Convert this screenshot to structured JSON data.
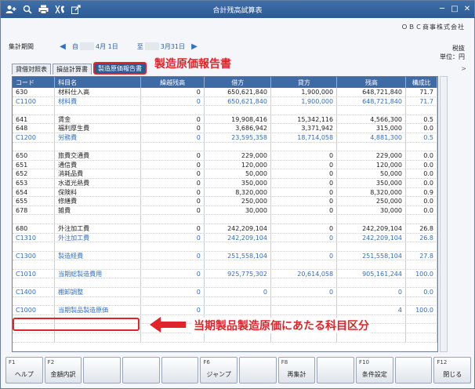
{
  "window": {
    "title": "合計残高試算表"
  },
  "company": "ＯＢＣ商事株式会社",
  "period": {
    "label": "集計期間",
    "from_prefix": "自",
    "from_date": "4月 1日",
    "to_prefix": "至",
    "to_date": "3月31日"
  },
  "tax_label": "税抜",
  "unit_label": "単位：円",
  "tabs": [
    {
      "label": "貸借対照表",
      "active": false
    },
    {
      "label": "損益計算書",
      "active": false
    },
    {
      "label": "製造原価報告書",
      "active": true
    }
  ],
  "callout_title": "製造原価報告書",
  "callout_bottom": "当期製品製造原価にあたる科目区分",
  "table": {
    "headers": [
      "コード",
      "科目名",
      "繰越残高",
      "借方",
      "貸方",
      "残高",
      "構成比"
    ],
    "rows": [
      {
        "code": "630",
        "name": "材料仕入高",
        "open": "0",
        "debit": "650,621,840",
        "credit": "1,900,000",
        "bal": "648,721,840",
        "ratio": "71.7",
        "type": "item"
      },
      {
        "code": "C1100",
        "name": "材料費",
        "open": "0",
        "debit": "650,621,840",
        "credit": "1,900,000",
        "bal": "648,721,840",
        "ratio": "71.7",
        "type": "sub"
      },
      {
        "code": "",
        "name": "",
        "open": "",
        "debit": "",
        "credit": "",
        "bal": "",
        "ratio": "",
        "type": "blank"
      },
      {
        "code": "641",
        "name": "賃金",
        "open": "0",
        "debit": "19,908,416",
        "credit": "15,342,116",
        "bal": "4,566,300",
        "ratio": "0.5",
        "type": "item"
      },
      {
        "code": "648",
        "name": "福利厚生費",
        "open": "0",
        "debit": "3,686,942",
        "credit": "3,371,942",
        "bal": "315,000",
        "ratio": "0.0",
        "type": "item"
      },
      {
        "code": "C1200",
        "name": "労務費",
        "open": "0",
        "debit": "23,595,358",
        "credit": "18,714,058",
        "bal": "4,881,300",
        "ratio": "0.5",
        "type": "sub"
      },
      {
        "code": "",
        "name": "",
        "open": "",
        "debit": "",
        "credit": "",
        "bal": "",
        "ratio": "",
        "type": "blank"
      },
      {
        "code": "650",
        "name": "旅費交通費",
        "open": "0",
        "debit": "229,000",
        "credit": "0",
        "bal": "229,000",
        "ratio": "0.0",
        "type": "item"
      },
      {
        "code": "651",
        "name": "通信費",
        "open": "0",
        "debit": "120,000",
        "credit": "0",
        "bal": "120,000",
        "ratio": "0.0",
        "type": "item"
      },
      {
        "code": "652",
        "name": "消耗品費",
        "open": "0",
        "debit": "50,000",
        "credit": "0",
        "bal": "50,000",
        "ratio": "0.0",
        "type": "item"
      },
      {
        "code": "653",
        "name": "水道光熱費",
        "open": "0",
        "debit": "350,000",
        "credit": "0",
        "bal": "350,000",
        "ratio": "0.0",
        "type": "item"
      },
      {
        "code": "654",
        "name": "保険料",
        "open": "0",
        "debit": "8,320,000",
        "credit": "0",
        "bal": "8,320,000",
        "ratio": "0.9",
        "type": "item"
      },
      {
        "code": "655",
        "name": "修繕費",
        "open": "0",
        "debit": "250,000",
        "credit": "0",
        "bal": "250,000",
        "ratio": "0.0",
        "type": "item"
      },
      {
        "code": "678",
        "name": "雑費",
        "open": "0",
        "debit": "30,000",
        "credit": "0",
        "bal": "30,000",
        "ratio": "0.0",
        "type": "item"
      },
      {
        "code": "",
        "name": "",
        "open": "",
        "debit": "",
        "credit": "",
        "bal": "",
        "ratio": "",
        "type": "blank"
      },
      {
        "code": "680",
        "name": "外注加工費",
        "open": "0",
        "debit": "242,209,104",
        "credit": "0",
        "bal": "242,209,104",
        "ratio": "26.8",
        "type": "item"
      },
      {
        "code": "C1310",
        "name": "外注加工費",
        "open": "0",
        "debit": "242,209,104",
        "credit": "0",
        "bal": "242,209,104",
        "ratio": "26.8",
        "type": "sub"
      },
      {
        "code": "",
        "name": "",
        "open": "",
        "debit": "",
        "credit": "",
        "bal": "",
        "ratio": "",
        "type": "blank"
      },
      {
        "code": "C1300",
        "name": "製造経費",
        "open": "0",
        "debit": "251,558,104",
        "credit": "0",
        "bal": "251,558,104",
        "ratio": "27.8",
        "type": "sub"
      },
      {
        "code": "",
        "name": "",
        "open": "",
        "debit": "",
        "credit": "",
        "bal": "",
        "ratio": "",
        "type": "blank"
      },
      {
        "code": "C1010",
        "name": "当期総製造費用",
        "open": "0",
        "debit": "925,775,302",
        "credit": "20,614,058",
        "bal": "905,161,244",
        "ratio": "100.0",
        "type": "sub"
      },
      {
        "code": "",
        "name": "",
        "open": "",
        "debit": "",
        "credit": "",
        "bal": "",
        "ratio": "",
        "type": "blank"
      },
      {
        "code": "C1400",
        "name": "棚卸調整",
        "open": "0",
        "debit": "0",
        "credit": "0",
        "bal": "0",
        "ratio": "0.0",
        "type": "sub"
      },
      {
        "code": "",
        "name": "",
        "open": "",
        "debit": "",
        "credit": "",
        "bal": "",
        "ratio": "",
        "type": "blank"
      },
      {
        "code": "C1000",
        "name": "当期製品製造原価",
        "open": "0",
        "debit": "",
        "credit": "",
        "bal": "4",
        "ratio": "100.0",
        "type": "sub"
      },
      {
        "code": "",
        "name": "",
        "open": "",
        "debit": "",
        "credit": "",
        "bal": "",
        "ratio": "",
        "type": "blank"
      },
      {
        "code": "",
        "name": "",
        "open": "",
        "debit": "",
        "credit": "",
        "bal": "",
        "ratio": "",
        "type": "blank"
      },
      {
        "code": "",
        "name": "",
        "open": "",
        "debit": "",
        "credit": "",
        "bal": "",
        "ratio": "",
        "type": "blank"
      }
    ]
  },
  "fkeys": [
    {
      "num": "F1",
      "label": "ヘルプ"
    },
    {
      "num": "F2",
      "label": "金額内訳"
    },
    {
      "num": "",
      "label": ""
    },
    {
      "num": "",
      "label": ""
    },
    {
      "num": "",
      "label": ""
    },
    {
      "num": "F6",
      "label": "ジャンプ"
    },
    {
      "num": "",
      "label": ""
    },
    {
      "num": "F8",
      "label": "再集計"
    },
    {
      "num": "",
      "label": ""
    },
    {
      "num": "F10",
      "label": "条件設定"
    },
    {
      "num": "",
      "label": ""
    },
    {
      "num": "F12",
      "label": "閉じる"
    }
  ],
  "colors": {
    "title_bar": "#2c5a94",
    "header": "#3e6aa6",
    "accent_red": "#e2232a",
    "subtotal_blue": "#2e6fc5"
  },
  "toolbar_icons": [
    "add-user-icon",
    "zoom-icon",
    "print-icon",
    "settings-tool-icon",
    "export-icon"
  ]
}
